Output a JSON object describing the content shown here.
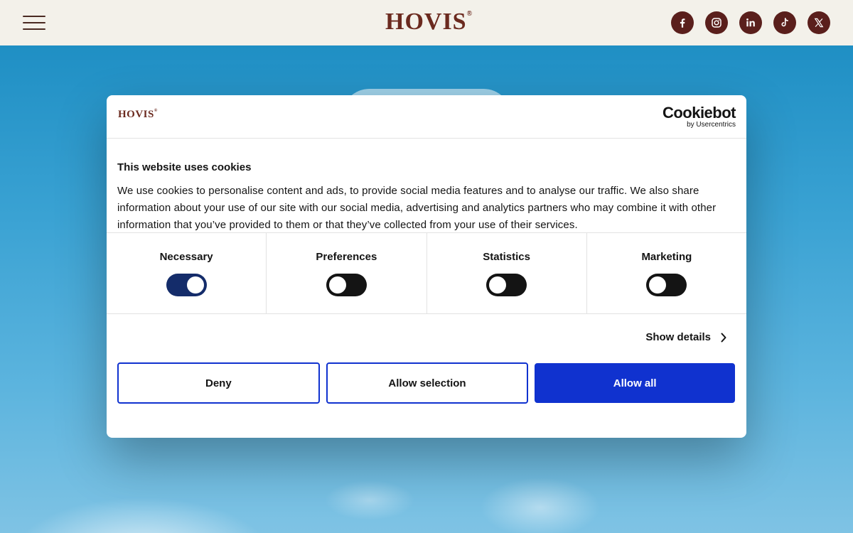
{
  "header": {
    "logo_text": "HOVIS",
    "logo_mark": "®",
    "socials": [
      {
        "icon": "facebook-icon"
      },
      {
        "icon": "instagram-icon"
      },
      {
        "icon": "linkedin-icon"
      },
      {
        "icon": "tiktok-icon"
      },
      {
        "icon": "x-icon"
      }
    ]
  },
  "dialog": {
    "logo_text": "HOVIS",
    "logo_mark": "®",
    "cookiebot_name": "Cookiebot",
    "cookiebot_by": "by Usercentrics",
    "title": "This website uses cookies",
    "text": "We use cookies to personalise content and ads, to provide social media features and to analyse our traffic. We also share information about your use of our site with our social media, advertising and analytics partners who may combine it with other information that you’ve provided to them or that they’ve collected from your use of their services.",
    "categories": [
      {
        "label": "Necessary",
        "enabled": true
      },
      {
        "label": "Preferences",
        "enabled": false
      },
      {
        "label": "Statistics",
        "enabled": false
      },
      {
        "label": "Marketing",
        "enabled": false
      }
    ],
    "show_details": "Show details",
    "buttons": {
      "deny": "Deny",
      "allow_selection": "Allow selection",
      "allow_all": "Allow all"
    }
  },
  "colors": {
    "brand": "#6b2a1f",
    "accent": "#1032cf",
    "toggle_on": "#142c6a"
  }
}
